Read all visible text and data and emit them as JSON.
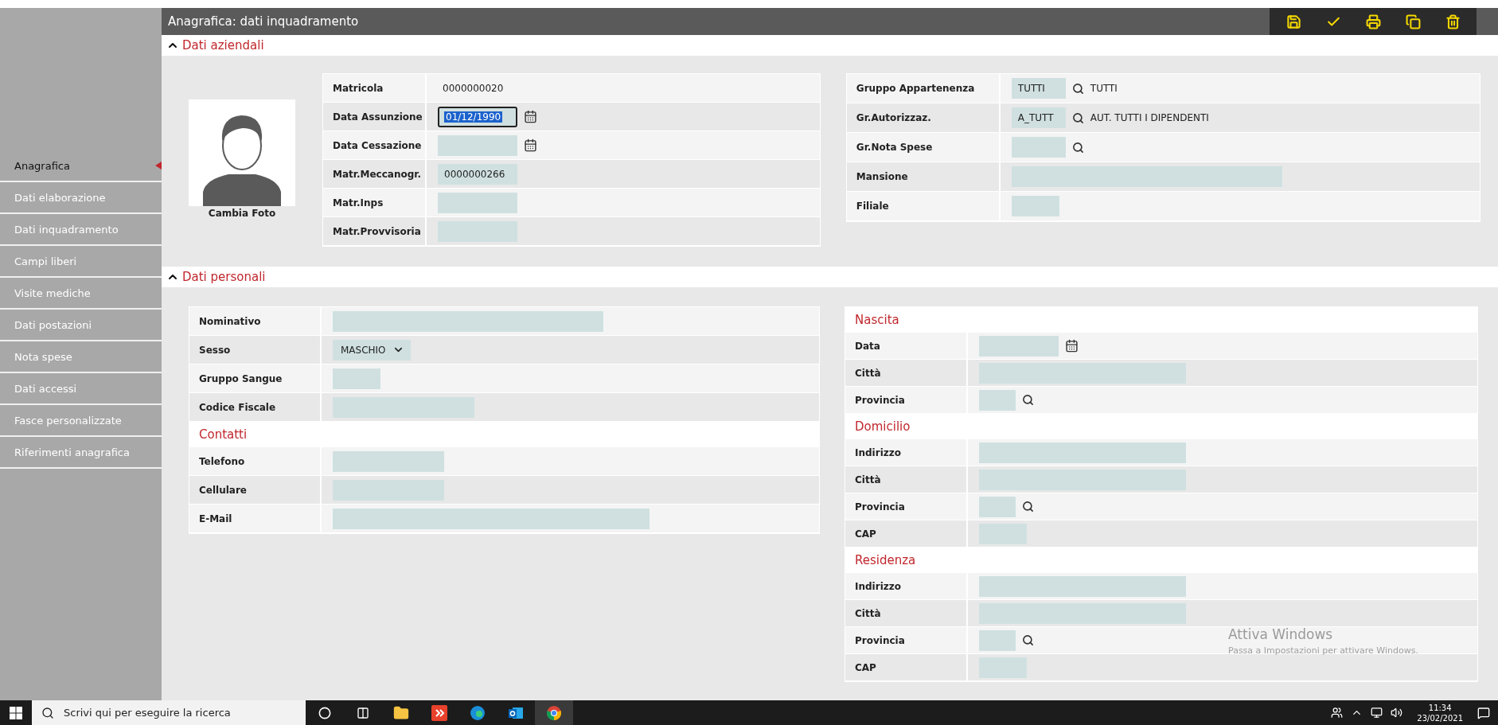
{
  "header": {
    "title": "Anagrafica: dati inquadramento",
    "tools": [
      {
        "kind": "save"
      },
      {
        "kind": "confirm"
      },
      {
        "kind": "print"
      },
      {
        "kind": "copy"
      },
      {
        "kind": "delete"
      }
    ]
  },
  "sidebar": {
    "items": [
      {
        "label": "Anagrafica",
        "selected": true
      },
      {
        "label": "Dati elaborazione",
        "selected": false
      },
      {
        "label": "Dati inquadramento",
        "selected": false
      },
      {
        "label": "Campi liberi",
        "selected": false
      },
      {
        "label": "Visite mediche",
        "selected": false
      },
      {
        "label": "Dati postazioni",
        "selected": false
      },
      {
        "label": "Nota spese",
        "selected": false
      },
      {
        "label": "Dati accessi",
        "selected": false
      },
      {
        "label": "Fasce personalizzate",
        "selected": false
      },
      {
        "label": "Riferimenti anagrafica",
        "selected": false
      }
    ]
  },
  "company_section": {
    "title": "Dati aziendali",
    "expanded": true,
    "photo": {
      "caption": "Cambia Foto"
    },
    "left_table": [
      {
        "kind": "field",
        "label": "Matricola",
        "input": {
          "kind": "text",
          "value": "0000000020"
        }
      },
      {
        "kind": "field",
        "label": "Data Assunzione",
        "input": {
          "kind": "date",
          "value": "01/12/1990",
          "focused": true
        }
      },
      {
        "kind": "field",
        "label": "Data Cessazione",
        "input": {
          "kind": "date",
          "focused": false
        }
      },
      {
        "kind": "field",
        "label": "Matr.Meccanogr.",
        "input": {
          "kind": "code",
          "value": "0000000266"
        }
      },
      {
        "kind": "field",
        "label": "Matr.Inps",
        "input": {
          "kind": "code"
        }
      },
      {
        "kind": "field",
        "label": "Matr.Provvisoria",
        "input": {
          "kind": "code"
        }
      }
    ],
    "right_table": [
      {
        "kind": "field",
        "label": "Gruppo Appartenenza",
        "input": {
          "kind": "lookup",
          "value": "TUTTI",
          "description": "TUTTI"
        }
      },
      {
        "kind": "field",
        "label": "Gr.Autorizzaz.",
        "input": {
          "kind": "lookup",
          "value": "A_TUTT",
          "description": "AUT. TUTTI I DIPENDENTI"
        }
      },
      {
        "kind": "field",
        "label": "Gr.Nota Spese",
        "input": {
          "kind": "lookup"
        }
      },
      {
        "kind": "field",
        "label": "Mansione",
        "input": {
          "kind": "long"
        }
      },
      {
        "kind": "field",
        "label": "Filiale",
        "input": {
          "kind": "short"
        }
      }
    ]
  },
  "personal_section": {
    "title": "Dati personali",
    "expanded": true,
    "left_table": [
      {
        "kind": "field",
        "label": "Nominativo",
        "input": {
          "kind": "long"
        }
      },
      {
        "kind": "field",
        "label": "Sesso",
        "input": {
          "kind": "select",
          "value": "MASCHIO"
        }
      },
      {
        "kind": "field",
        "label": "Gruppo Sangue",
        "input": {
          "kind": "short"
        }
      },
      {
        "kind": "field",
        "label": "Codice Fiscale",
        "input": {
          "kind": "medium"
        }
      },
      {
        "kind": "heading",
        "label": "Contatti"
      },
      {
        "kind": "field",
        "label": "Telefono",
        "input": {
          "kind": "phone"
        }
      },
      {
        "kind": "field",
        "label": "Cellulare",
        "input": {
          "kind": "phone"
        }
      },
      {
        "kind": "field",
        "label": "E-Mail",
        "input": {
          "kind": "longest"
        }
      }
    ],
    "right_table": [
      {
        "kind": "heading",
        "label": "Nascita"
      },
      {
        "kind": "field",
        "label": "Data",
        "input": {
          "kind": "date",
          "focused": false
        }
      },
      {
        "kind": "field",
        "label": "Città",
        "input": {
          "kind": "wide"
        }
      },
      {
        "kind": "field",
        "label": "Provincia",
        "input": {
          "kind": "province"
        }
      },
      {
        "kind": "heading",
        "label": "Domicilio"
      },
      {
        "kind": "field",
        "label": "Indirizzo",
        "input": {
          "kind": "wide"
        }
      },
      {
        "kind": "field",
        "label": "Città",
        "input": {
          "kind": "wide"
        }
      },
      {
        "kind": "field",
        "label": "Provincia",
        "input": {
          "kind": "province"
        }
      },
      {
        "kind": "field",
        "label": "CAP",
        "input": {
          "kind": "short"
        }
      },
      {
        "kind": "heading",
        "label": "Residenza"
      },
      {
        "kind": "field",
        "label": "Indirizzo",
        "input": {
          "kind": "wide"
        }
      },
      {
        "kind": "field",
        "label": "Città",
        "input": {
          "kind": "wide"
        }
      },
      {
        "kind": "field",
        "label": "Provincia",
        "input": {
          "kind": "province"
        }
      },
      {
        "kind": "field",
        "label": "CAP",
        "input": {
          "kind": "short"
        }
      }
    ]
  },
  "activation_notice": {
    "title": "Attiva Windows",
    "subtitle": "Passa a Impostazioni per attivare Windows."
  },
  "taskbar": {
    "search": {
      "placeholder": "Scrivi qui per eseguire la ricerca"
    },
    "apps": [
      {
        "kind": "cortana"
      },
      {
        "kind": "taskview"
      },
      {
        "kind": "folder"
      },
      {
        "kind": "remote"
      },
      {
        "kind": "edge"
      },
      {
        "kind": "outlook"
      },
      {
        "kind": "chrome",
        "selected": true
      }
    ],
    "time": "11:34",
    "date": "23/02/2021"
  }
}
